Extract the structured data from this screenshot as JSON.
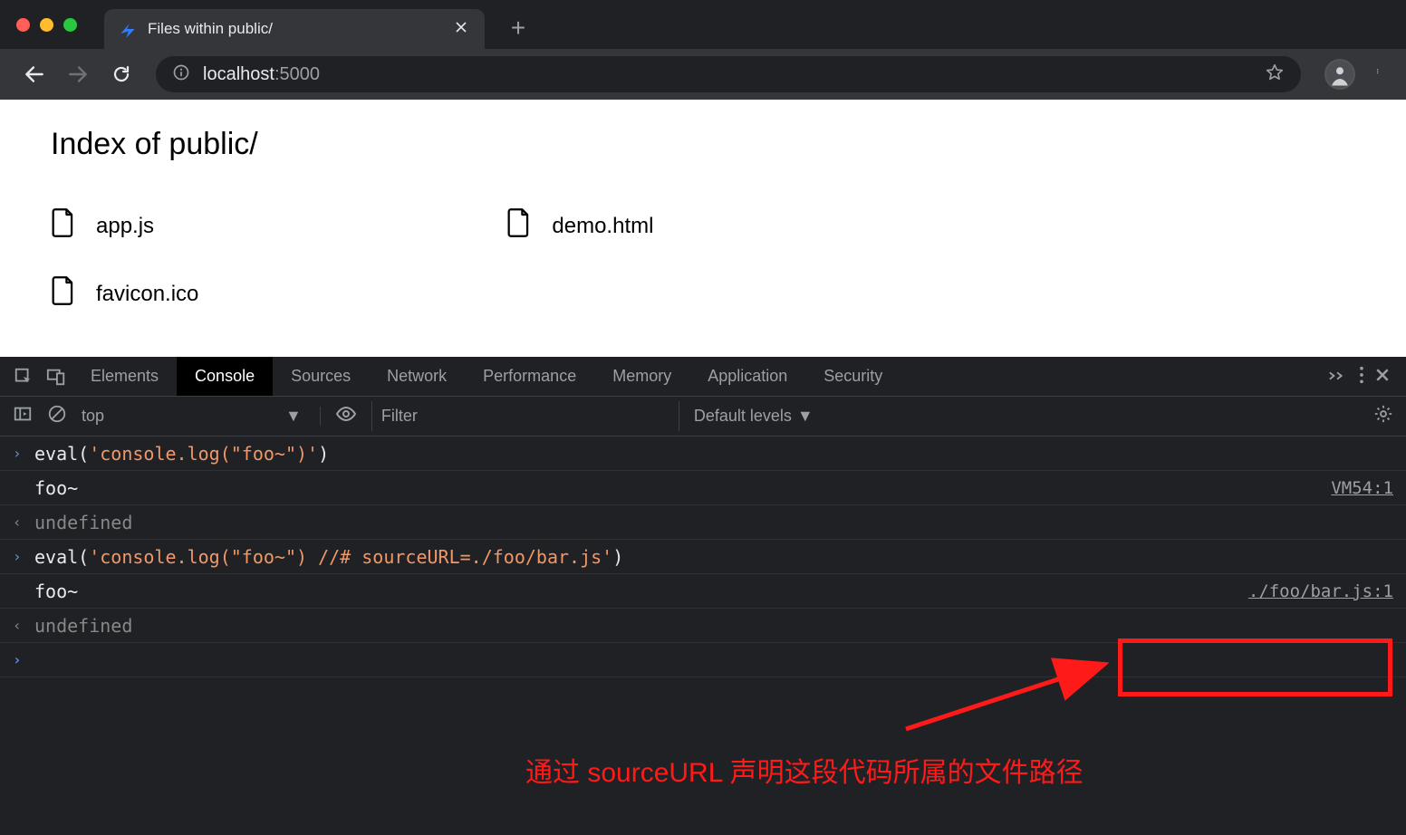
{
  "browser": {
    "tab_title": "Files within public/",
    "url_host": "localhost",
    "url_port": ":5000"
  },
  "page": {
    "heading": "Index of  public/",
    "files": [
      {
        "name": "app.js"
      },
      {
        "name": "demo.html"
      },
      {
        "name": "favicon.ico"
      }
    ]
  },
  "devtools": {
    "tabs": [
      "Elements",
      "Console",
      "Sources",
      "Network",
      "Performance",
      "Memory",
      "Application",
      "Security"
    ],
    "active_tab": "Console",
    "console_toolbar": {
      "context": "top",
      "filter_placeholder": "Filter",
      "levels": "Default levels"
    },
    "console": [
      {
        "type": "input",
        "text": "eval('console.log(\"foo~\")')"
      },
      {
        "type": "log",
        "text": "foo~",
        "source": "VM54:1"
      },
      {
        "type": "result",
        "text": "undefined"
      },
      {
        "type": "input",
        "text": "eval('console.log(\"foo~\") //# sourceURL=./foo/bar.js')"
      },
      {
        "type": "log",
        "text": "foo~",
        "source": "./foo/bar.js:1"
      },
      {
        "type": "result",
        "text": "undefined"
      },
      {
        "type": "prompt",
        "text": ""
      }
    ]
  },
  "annotation": {
    "text": "通过 sourceURL 声明这段代码所属的文件路径"
  }
}
